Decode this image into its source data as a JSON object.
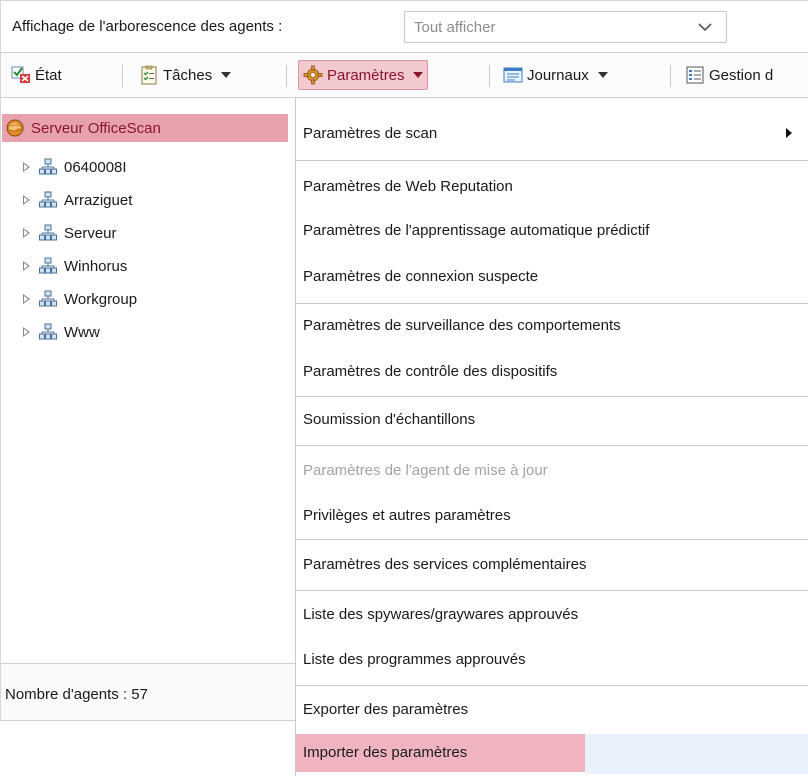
{
  "viewbar": {
    "label": "Affichage de l'arborescence des agents :",
    "select_value": "Tout afficher"
  },
  "toolbar": {
    "etat": "État",
    "taches": "Tâches",
    "parametres": "Paramètres",
    "journaux": "Journaux",
    "gestion": "Gestion d"
  },
  "tree": {
    "root": "Serveur OfficeScan",
    "nodes": [
      "0640008I",
      "Arraziguet",
      "Serveur",
      "Winhorus",
      "Workgroup",
      "Www"
    ]
  },
  "footer": {
    "agents_count": "Nombre d'agents : 57"
  },
  "menu": {
    "items": [
      "Paramètres de scan",
      "Paramètres de Web Reputation",
      "Paramètres de l'apprentissage automatique prédictif",
      "Paramètres de connexion suspecte",
      "Paramètres de surveillance des comportements",
      "Paramètres de contrôle des dispositifs",
      "Soumission d'échantillons",
      "Paramètres de l'agent de mise à jour",
      "Privilèges et autres paramètres",
      "Paramètres des services complémentaires",
      "Liste des spywares/graywares approuvés",
      "Liste des programmes approuvés",
      "Exporter des paramètres",
      "Importer des paramètres"
    ]
  },
  "colors": {
    "selection_pink": "#e7a2ad",
    "button_active": "#f2c9cf",
    "root_text": "#8a1530",
    "disabled_text": "#a3a3a3"
  }
}
